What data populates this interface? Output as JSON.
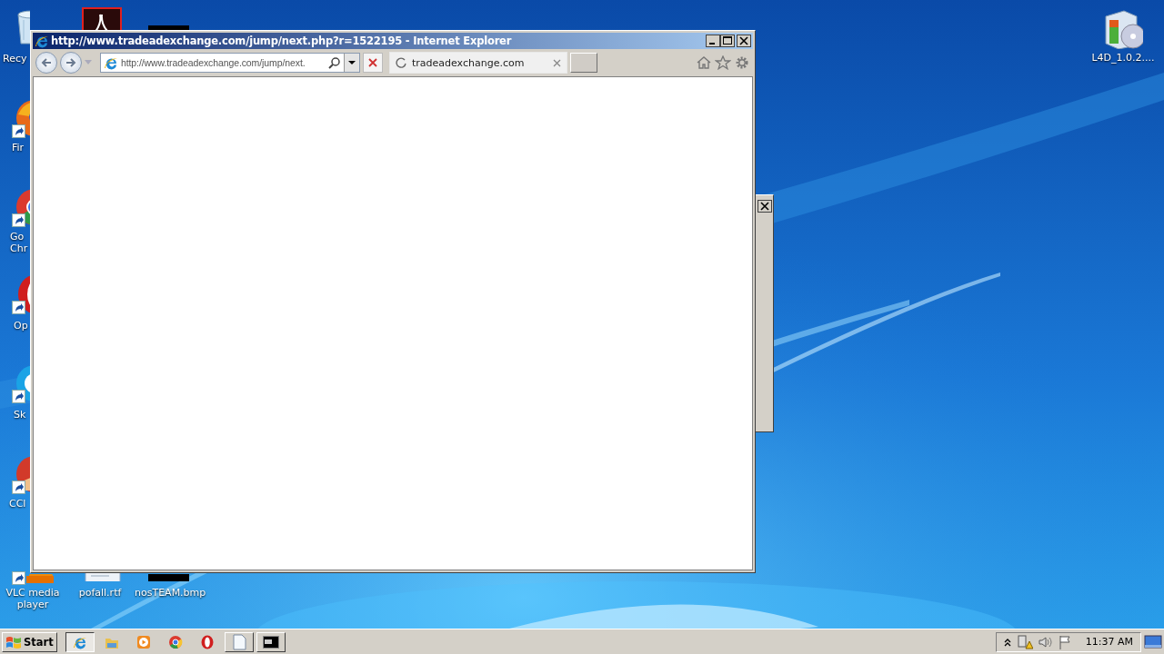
{
  "desktop_icons": [
    {
      "kind": "recycle-bin",
      "label": "Recy",
      "shortcut": false
    },
    {
      "kind": "pdf",
      "shortcut": false
    },
    {
      "kind": "dark-image",
      "shortcut": false
    },
    {
      "kind": "firefox",
      "label": "Fir",
      "shortcut": true
    },
    {
      "kind": "chrome",
      "label": "Go Chr",
      "shortcut": true
    },
    {
      "kind": "opera",
      "label": "Op",
      "shortcut": true
    },
    {
      "kind": "skype",
      "label": "Sk",
      "shortcut": true
    },
    {
      "kind": "ccleaner",
      "label": "CCl",
      "shortcut": true
    },
    {
      "kind": "vlc",
      "label": "VLC media player",
      "shortcut": true
    },
    {
      "kind": "document",
      "label": "pofall.rtf",
      "shortcut": false
    },
    {
      "kind": "dark-image",
      "label": "nosTEAM.bmp",
      "shortcut": false
    },
    {
      "kind": "installer",
      "label": "L4D_1.0.2....",
      "shortcut": false
    }
  ],
  "window": {
    "title": "http://www.tradeadexchange.com/jump/next.php?r=1522195 - Internet Explorer",
    "address": "http://www.tradeadexchange.com/jump/next.",
    "tab": {
      "label": "tradeadexchange.com",
      "loading": true
    }
  },
  "taskbar": {
    "start": "Start",
    "items": [
      {
        "kind": "ie",
        "open": true,
        "selected": true
      },
      {
        "kind": "explorer",
        "open": false,
        "selected": false
      },
      {
        "kind": "media",
        "open": false,
        "selected": false
      },
      {
        "kind": "chrome",
        "open": false,
        "selected": false
      },
      {
        "kind": "opera",
        "open": false,
        "selected": false
      },
      {
        "kind": "notepad",
        "open": true,
        "selected": false
      },
      {
        "kind": "cmd",
        "open": true,
        "selected": false
      }
    ],
    "clock": "11:37 AM"
  }
}
